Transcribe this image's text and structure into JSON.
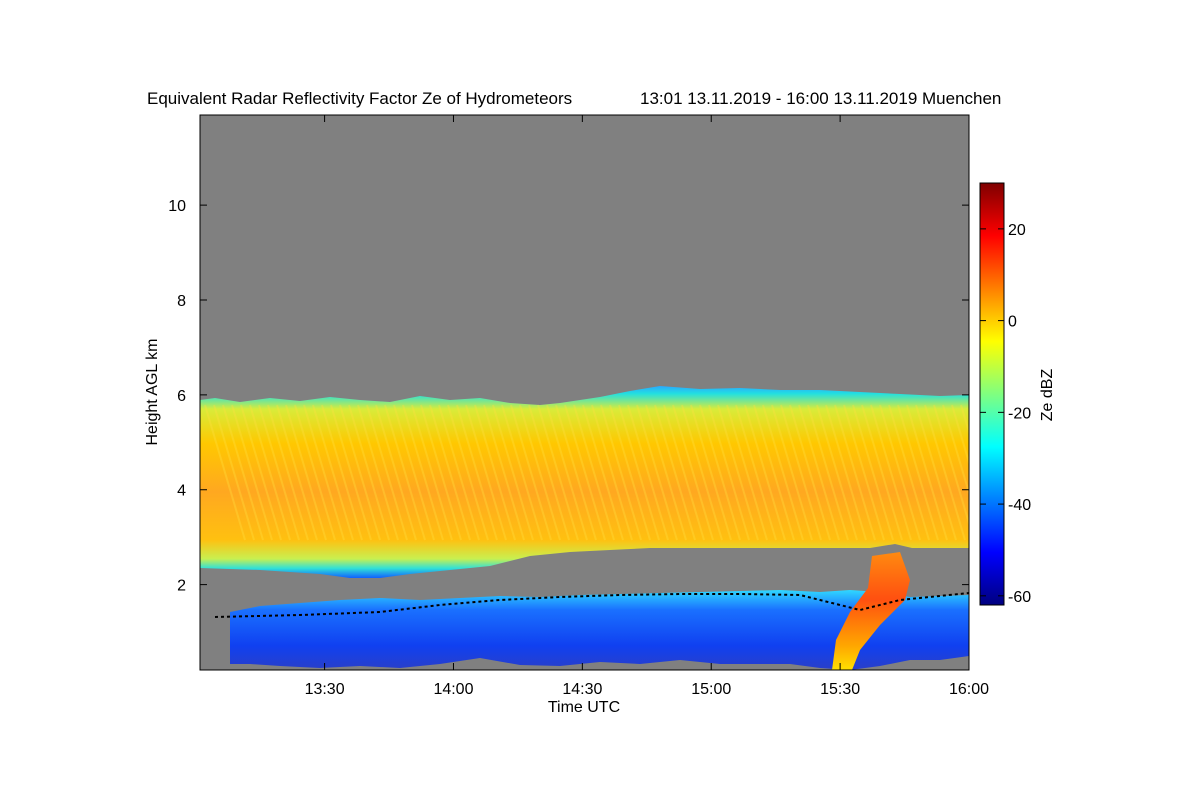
{
  "chart_data": {
    "type": "heatmap",
    "title": "Equivalent Radar Reflectivity Factor Ze of Hydrometeors",
    "title_time_range": "13:01 13.11.2019 - 16:00 13.11.2019 Muenchen",
    "xlabel": "Time UTC",
    "ylabel": "Height AGL km",
    "x_ticks": [
      "13:30",
      "14:00",
      "14:30",
      "15:00",
      "15:30",
      "16:00"
    ],
    "y_ticks": [
      "2",
      "4",
      "6",
      "8",
      "10"
    ],
    "colorbar_label": "Ze dBZ",
    "colorbar_ticks": [
      "20",
      "0",
      "-20",
      "-40",
      "-60"
    ],
    "colorbar_range": [
      -62,
      30
    ],
    "ylim": [
      0.2,
      11.9
    ],
    "xlim": [
      "13:01",
      "16:00"
    ],
    "background_color": "#808080",
    "colormap": "jet",
    "layers": [
      {
        "name": "upper cloud layer",
        "height_range_km": [
          2.5,
          6.0
        ],
        "ze_range_dbz": [
          -30,
          10
        ]
      },
      {
        "name": "lower cloud layer",
        "height_range_km": [
          0.2,
          2.0
        ],
        "ze_range_dbz": [
          -55,
          20
        ]
      }
    ]
  }
}
